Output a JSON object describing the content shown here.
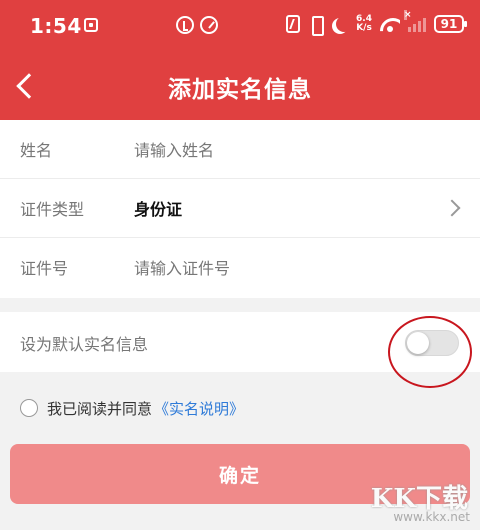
{
  "colors": {
    "accent": "#e04040",
    "button": "#f08a8a",
    "link": "#2f7bd8"
  },
  "status_bar": {
    "time": "1:54",
    "speed_top": "6.4",
    "speed_bottom": "K/s",
    "battery": "91"
  },
  "header": {
    "title": "添加实名信息",
    "back_icon": "chevron-left-icon"
  },
  "form": {
    "name": {
      "label": "姓名",
      "placeholder": "请输入姓名",
      "value": ""
    },
    "id_type": {
      "label": "证件类型",
      "value": "身份证"
    },
    "id_number": {
      "label": "证件号",
      "placeholder": "请输入证件号",
      "value": ""
    }
  },
  "default_setting": {
    "label": "设为默认实名信息",
    "enabled": false
  },
  "agreement": {
    "text": "我已阅读并同意",
    "link": "《实名说明》",
    "checked": false
  },
  "confirm": {
    "label": "确定"
  },
  "watermark": {
    "logo": "KK下载",
    "url": "www.kkx.net"
  }
}
